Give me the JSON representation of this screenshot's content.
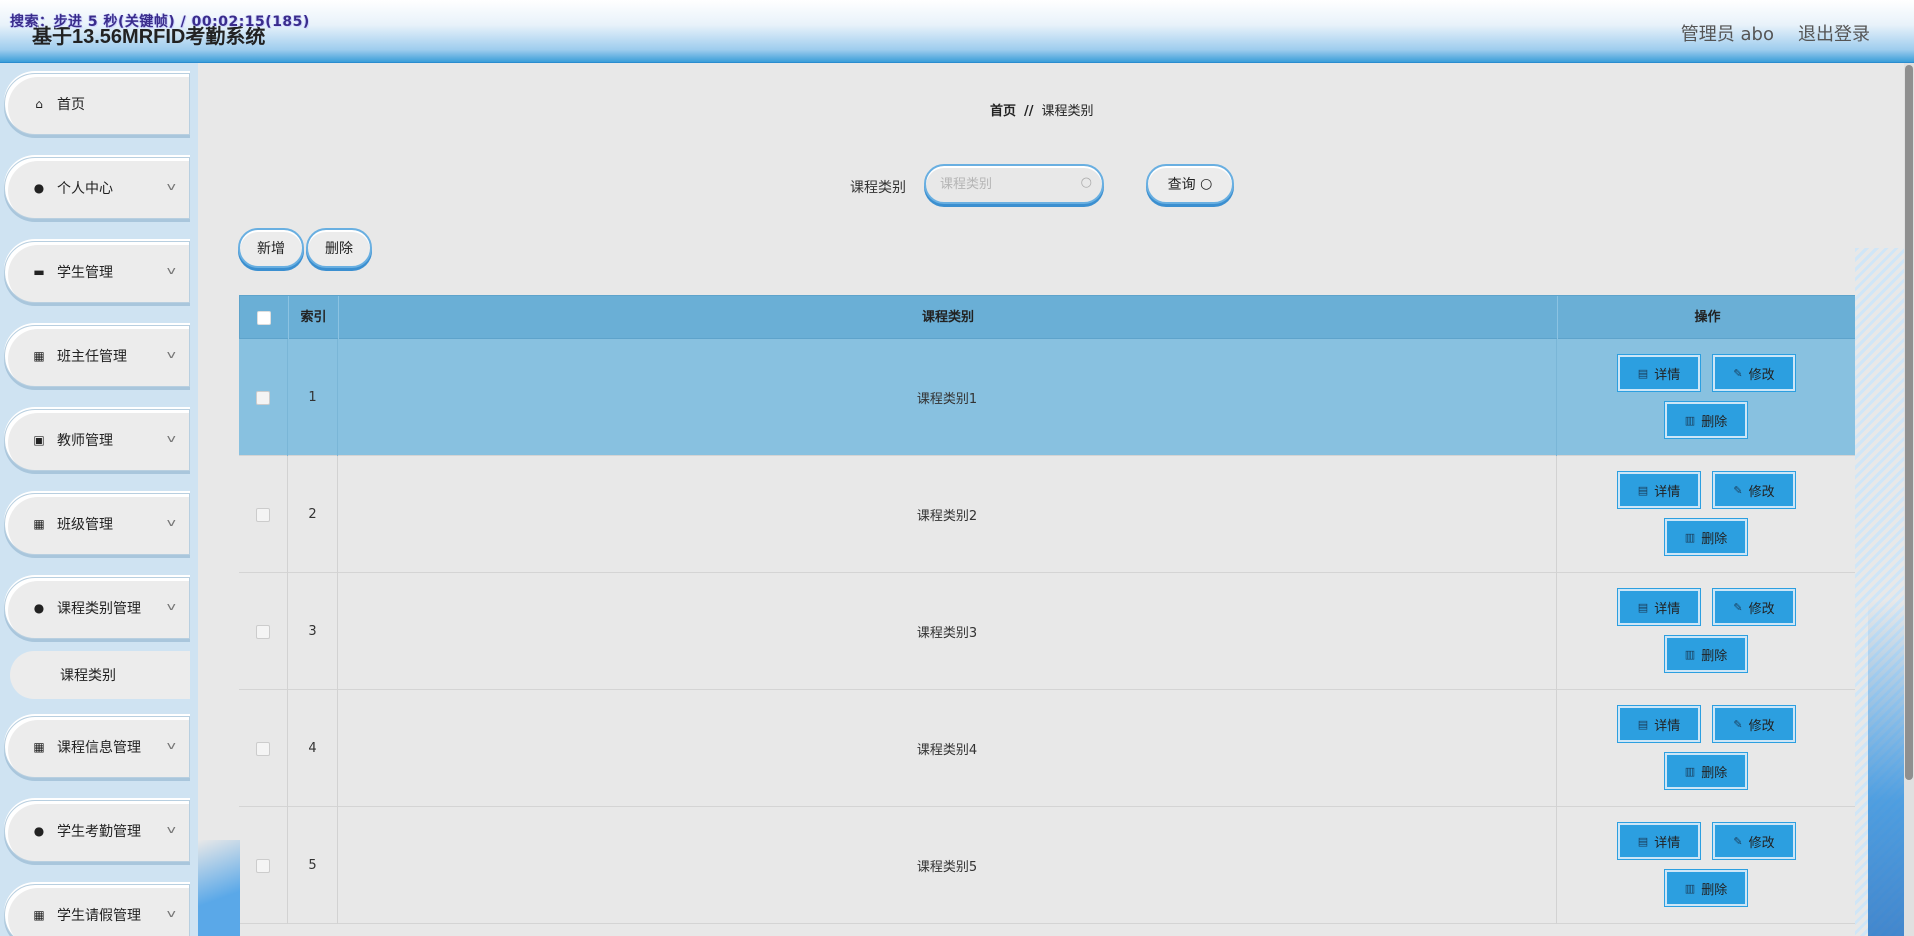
{
  "overlay": "搜索：步进 5 秒(关键帧) / 00:02:15(185)",
  "app_title": "基于13.56MRFID考勤系统",
  "header": {
    "user": "管理员 abo",
    "logout": "退出登录"
  },
  "sidebar": {
    "items": [
      {
        "label": "首页",
        "icon": "home-icon"
      },
      {
        "label": "个人中心",
        "icon": "user-icon"
      },
      {
        "label": "学生管理",
        "icon": "briefcase-icon"
      },
      {
        "label": "班主任管理",
        "icon": "grid-icon"
      },
      {
        "label": "教师管理",
        "icon": "clipboard-icon"
      },
      {
        "label": "班级管理",
        "icon": "grid-icon"
      },
      {
        "label": "课程类别管理",
        "icon": "user-icon"
      },
      {
        "label": "课程类别",
        "icon": ""
      },
      {
        "label": "课程信息管理",
        "icon": "grid-icon"
      },
      {
        "label": "学生考勤管理",
        "icon": "bulb-icon"
      },
      {
        "label": "学生请假管理",
        "icon": "grid-icon"
      }
    ]
  },
  "breadcrumb": {
    "home": "首页",
    "sep": "//",
    "current": "课程类别"
  },
  "search": {
    "label": "课程类别",
    "placeholder": "课程类别",
    "button": "查询"
  },
  "toolbar": {
    "add": "新增",
    "delete": "删除"
  },
  "table": {
    "headers": {
      "index": "索引",
      "category": "课程类别",
      "actions": "操作"
    },
    "rows": [
      {
        "index": "1",
        "category": "课程类别1"
      },
      {
        "index": "2",
        "category": "课程类别2"
      },
      {
        "index": "3",
        "category": "课程类别3"
      },
      {
        "index": "4",
        "category": "课程类别4"
      },
      {
        "index": "5",
        "category": "课程类别5"
      }
    ],
    "actions": {
      "detail": "详情",
      "edit": "修改",
      "delete": "删除"
    }
  },
  "colors": {
    "accent": "#2c9fe0",
    "header_row": "#6aafd6",
    "highlight_row": "#88c1e0"
  }
}
